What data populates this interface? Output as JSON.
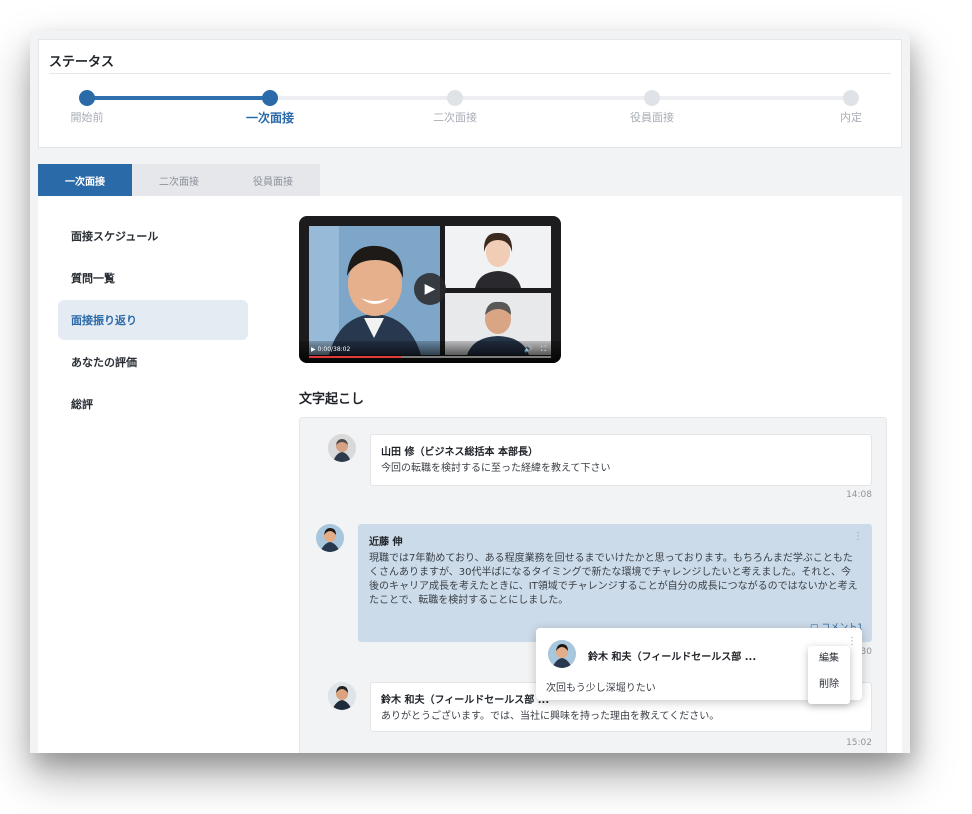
{
  "status": {
    "title": "ステータス",
    "stages": [
      "開始前",
      "一次面接",
      "二次面接",
      "役員面接",
      "内定"
    ],
    "current_stage": "一次面接"
  },
  "tabs": [
    "一次面接",
    "二次面接",
    "役員面接"
  ],
  "sidebar": {
    "items": [
      {
        "label": "面接スケジュール"
      },
      {
        "label": "質問一覧"
      },
      {
        "label": "面接振り返り"
      },
      {
        "label": "あなたの評価"
      },
      {
        "label": "総評"
      }
    ],
    "active": "面接振り返り"
  },
  "video": {
    "time": "0:00/38:02",
    "progress": 0.38
  },
  "transcript": {
    "title": "文字起こし",
    "messages": [
      {
        "name": "山田 修（ビジネス総括本 本部長）",
        "text": "今回の転職を検討するに至った経緯を教えて下さい",
        "time": "14:08"
      },
      {
        "name": "近藤 伸",
        "text": "現職では7年勤めており、ある程度業務を回せるまでいけたかと思っております。もちろんまだ学ぶこともたくさんありますが、30代半ばになるタイミングで新たな環境でチャレンジしたいと考えました。それと、今後のキャリア成長を考えたときに、IT領域でチャレンジすることが自分の成長につながるのではないかと考えたことで、転職を検討することにしました。",
        "comment_label": "コメント1",
        "time": "14:30"
      },
      {
        "name": "鈴木 和夫（フィールドセールス部 ...",
        "text": "ありがとうございます。では、当社に興味を持った理由を教えてください。",
        "time": "15:02"
      }
    ]
  },
  "comment_popup": {
    "name": "鈴木 和夫（フィールドセールス部 ...",
    "text": "次回もう少し深堀りたい",
    "menu": {
      "edit": "編集",
      "delete": "削除"
    }
  },
  "colors": {
    "accent": "#2b6aa8",
    "highlight": "#ccdbe9",
    "background": "#f2f3f5"
  }
}
